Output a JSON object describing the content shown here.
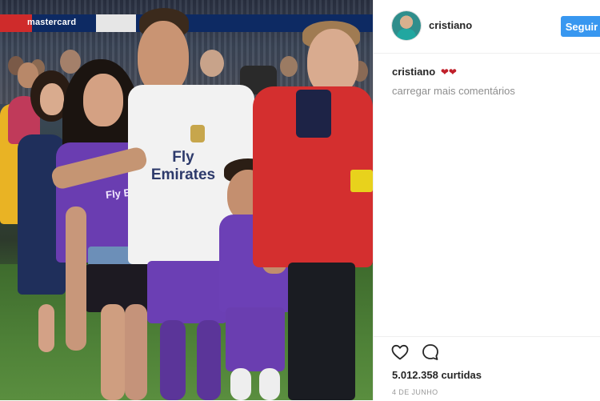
{
  "post": {
    "username": "cristiano",
    "follow_label": "Seguir",
    "caption_user": "cristiano",
    "caption_hearts": "❤❤",
    "load_more_label": "carregar mais comentários",
    "likes_text": "5.012.358 curtidas",
    "date_text": "4 DE JUNHO"
  },
  "photo": {
    "banner_text": "mastercard",
    "shirt_sponsor": "Fly Emirates",
    "shirt_sponsor_small": "Fly Emirates"
  },
  "colors": {
    "follow_button": "#3897f0",
    "text": "#262626",
    "muted": "#8e8e8e",
    "hearts": "#c0202a"
  },
  "icons": {
    "like": "heart-outline-icon",
    "comment": "comment-bubble-icon"
  }
}
